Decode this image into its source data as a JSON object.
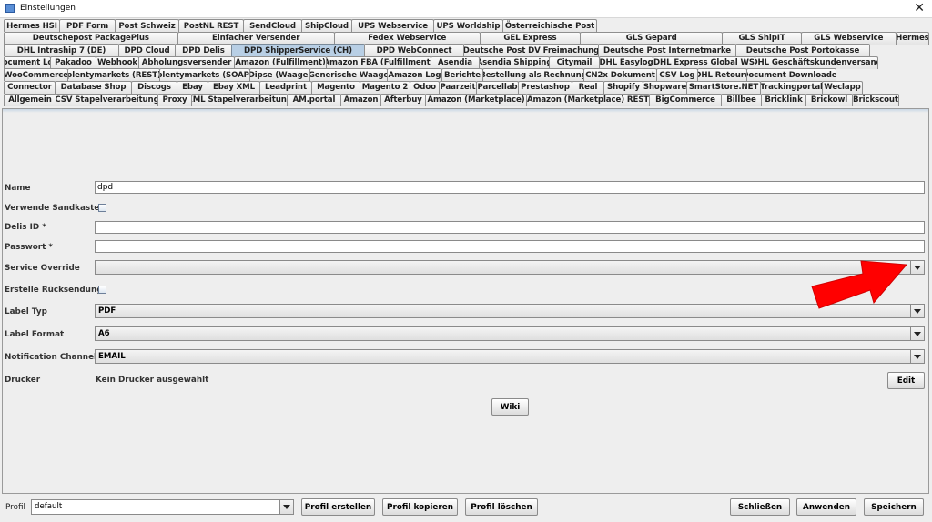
{
  "window": {
    "title": "Einstellungen",
    "close_glyph": "✕"
  },
  "tabs": {
    "rows": [
      [
        "Hermes HSI",
        "PDF Form",
        "Post Schweiz",
        "PostNL REST",
        "SendCloud",
        "ShipCloud",
        "UPS Webservice",
        "UPS Worldship",
        "Österreichische Post"
      ],
      [
        "Deutschepost PackagePlus",
        "Einfacher Versender",
        "Fedex Webservice",
        "GEL Express",
        "GLS Gepard",
        "GLS ShipIT",
        "GLS Webservice",
        "Hermes"
      ],
      [
        "DHL Intraship 7 (DE)",
        "DPD Cloud",
        "DPD Delis",
        "DPD ShipperService (CH)",
        "DPD WebConnect",
        "Deutsche Post DV Freimachung",
        "Deutsche Post Internetmarke",
        "Deutsche Post Portokasse"
      ],
      [
        "Document Log",
        "Pakadoo",
        "Webhook",
        "Abholungsversender",
        "Amazon (Fulfillment)",
        "Amazon FBA (Fulfillment)",
        "Asendia",
        "Asendia Shipping",
        "Citymail",
        "DHL Easylog",
        "DHL Express Global WS",
        "DHL Geschäftskundenversand"
      ],
      [
        "WooCommerce",
        "plentymarkets (REST)",
        "plentymarkets (SOAP)",
        "Dipse (Waage)",
        "Generische Waage",
        "Amazon Log",
        "Berichte",
        "Bestellung als Rechnung",
        "CN2x Dokument",
        "CSV Log",
        "DHL Retoure",
        "Document Downloader"
      ],
      [
        "Connector",
        "Database Shop",
        "Discogs",
        "Ebay",
        "Ebay XML",
        "Leadprint",
        "Magento",
        "Magento 2",
        "Odoo",
        "Paarzeit",
        "Parcellab",
        "Prestashop",
        "Real",
        "Shopify",
        "Shopware",
        "SmartStore.NET",
        "Trackingportal",
        "Weclapp"
      ],
      [
        "Allgemein",
        "CSV Stapelverarbeitung",
        "Proxy",
        "XML Stapelverarbeitung",
        "AM.portal",
        "Amazon",
        "Afterbuy",
        "Amazon (Marketplace)",
        "Amazon (Marketplace) REST",
        "BigCommerce",
        "Billbee",
        "Bricklink",
        "Brickowl",
        "Brickscout"
      ]
    ],
    "selected": "DPD ShipperService (CH)"
  },
  "form": {
    "name": {
      "label": "Name",
      "value": "dpd"
    },
    "sandbox": {
      "label": "Verwende Sandkasten",
      "checked": false
    },
    "delis_id": {
      "label": "Delis ID *",
      "value": ""
    },
    "password": {
      "label": "Passwort *",
      "value": ""
    },
    "service_override": {
      "label": "Service Override",
      "value": ""
    },
    "return_shipment": {
      "label": "Erstelle Rücksendung",
      "checked": false
    },
    "label_type": {
      "label": "Label Typ",
      "value": "PDF"
    },
    "label_format": {
      "label": "Label Format",
      "value": "A6"
    },
    "notification_channel": {
      "label": "Notification Channel",
      "value": "EMAIL"
    },
    "printer": {
      "label": "Drucker",
      "value": "Kein Drucker ausgewählt",
      "edit_label": "Edit"
    },
    "wiki_label": "Wiki"
  },
  "footer": {
    "profile_label": "Profil",
    "profile_value": "default",
    "create": "Profil erstellen",
    "copy": "Profil kopieren",
    "delete": "Profil löschen",
    "close": "Schließen",
    "apply": "Anwenden",
    "save": "Speichern"
  },
  "annotation": {
    "arrow_color": "#ff0000",
    "icon": "red-arrow-icon"
  }
}
